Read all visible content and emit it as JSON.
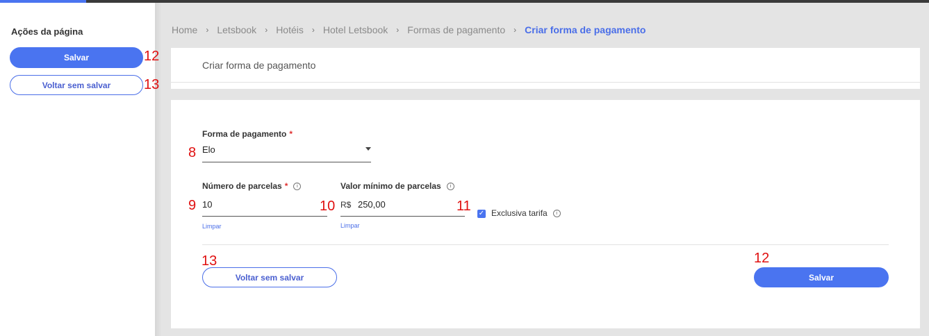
{
  "sidebar": {
    "title": "Ações da página",
    "save_label": "Salvar",
    "back_label": "Voltar sem salvar"
  },
  "annotations": {
    "side_save": "12",
    "side_back": "13",
    "payment": "8",
    "installments": "9",
    "min_value": "10",
    "exclusive": "11",
    "bottom_back": "13",
    "bottom_save": "12"
  },
  "breadcrumb": {
    "items": [
      "Home",
      "Letsbook",
      "Hotéis",
      "Hotel Letsbook",
      "Formas de pagamento"
    ],
    "current": "Criar forma de pagamento",
    "separator": "›"
  },
  "header": {
    "title": "Criar forma de pagamento"
  },
  "form": {
    "payment_method": {
      "label": "Forma de pagamento",
      "required_mark": "*",
      "value": "Elo"
    },
    "installments": {
      "label": "Número de parcelas",
      "required_mark": "*",
      "value": "10",
      "clear_label": "Limpar"
    },
    "min_installment_value": {
      "label": "Valor mínimo de parcelas",
      "prefix": "R$",
      "value": "250,00",
      "clear_label": "Limpar"
    },
    "exclusive_rate": {
      "label": "Exclusiva tarifa",
      "checked": true
    },
    "info_glyph": "i",
    "check_glyph": "✓",
    "back_label": "Voltar sem salvar",
    "save_label": "Salvar"
  },
  "colors": {
    "accent": "#4a74f0",
    "annotation": "#e01010",
    "required": "#e03030"
  }
}
